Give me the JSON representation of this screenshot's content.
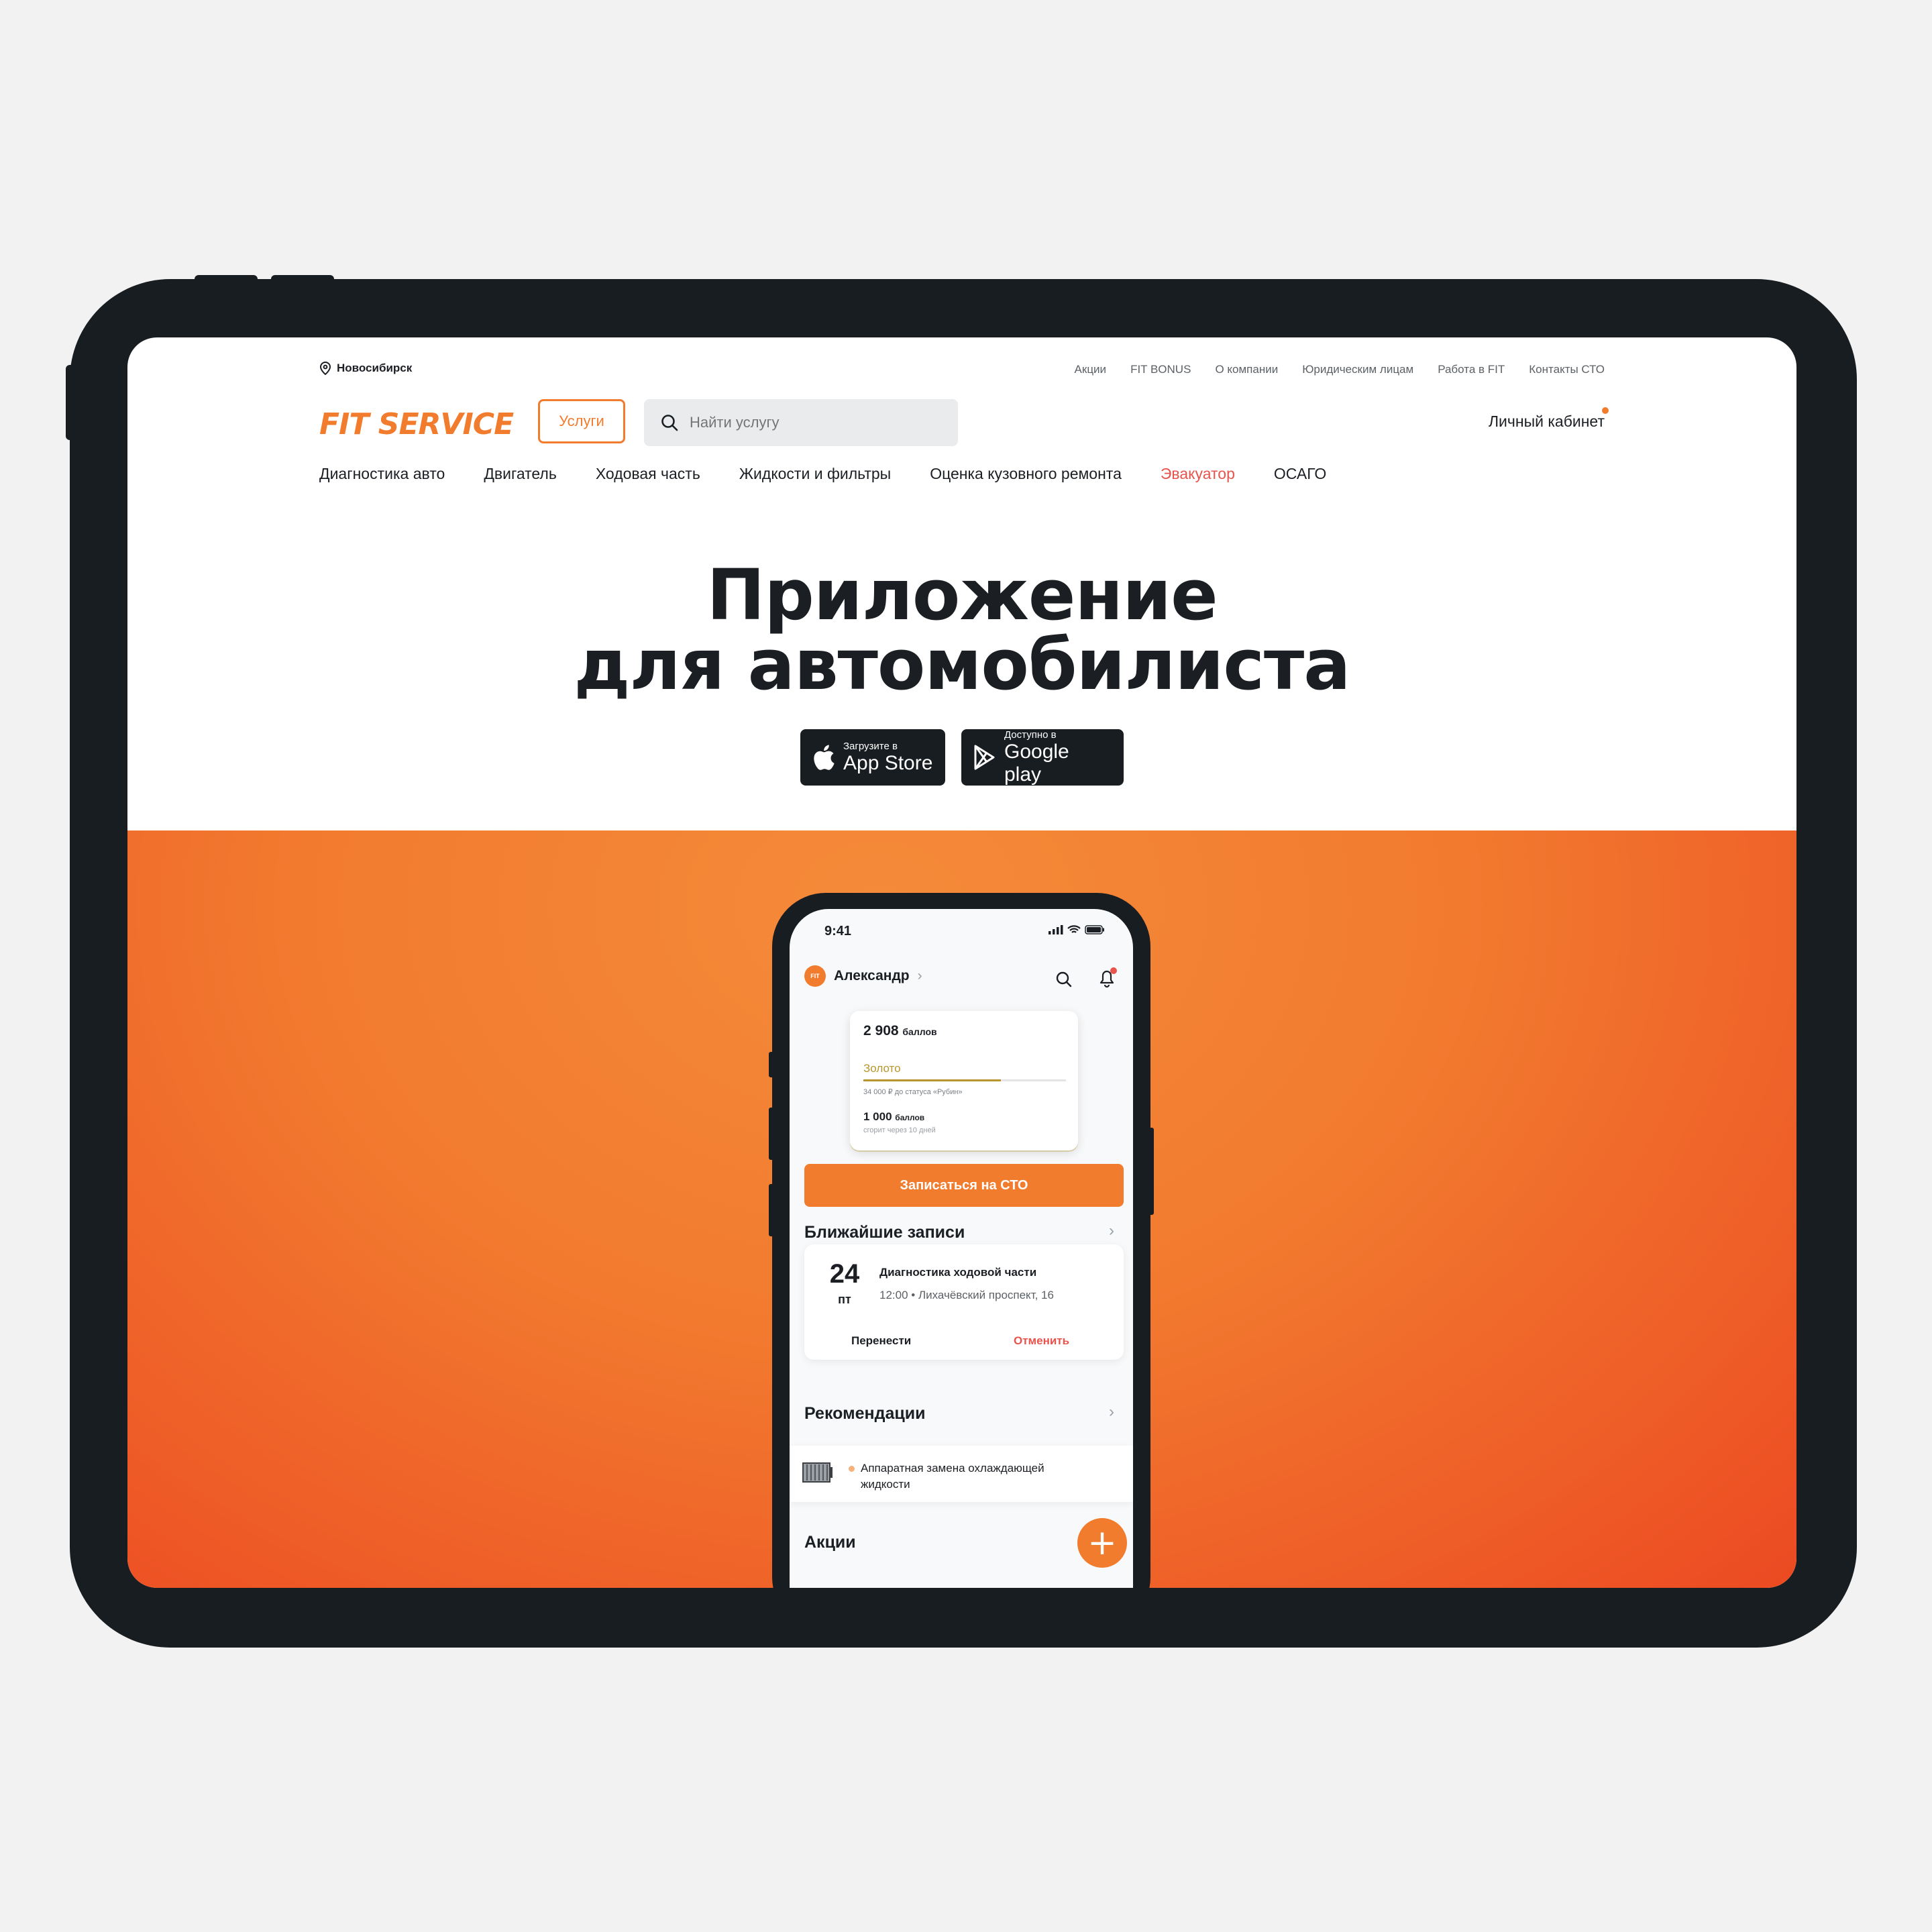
{
  "header": {
    "city": "Новосибирск",
    "top_links": [
      "Акции",
      "FIT BONUS",
      "О компании",
      "Юридическим лицам",
      "Работа в FIT",
      "Контакты СТО"
    ],
    "logo": "FIT SERVICE",
    "services_label": "Услуги",
    "search_placeholder": "Найти услугу",
    "cabinet_label": "Личный кабинет"
  },
  "nav": {
    "items": [
      "Диагностика авто",
      "Двигатель",
      "Ходовая часть",
      "Жидкости и фильтры",
      "Оценка кузовного ремонта",
      "Эвакуатор",
      "ОСАГО"
    ],
    "highlight_color": "#e8534c"
  },
  "hero": {
    "title_line1": "Приложение",
    "title_line2": "для автомобилиста",
    "appstore": {
      "small": "Загрузите в",
      "big": "App Store"
    },
    "googleplay": {
      "small": "Доступно в",
      "big": "Google play"
    }
  },
  "colors": {
    "accent": "#f27c2d",
    "dark": "#181d21",
    "gold": "#b8962e",
    "danger": "#e8534c"
  },
  "phone": {
    "time": "9:41",
    "user_name": "Александр",
    "avatar_text": "FIT",
    "points": {
      "value": "2 908",
      "unit": "баллов",
      "status": "Золото",
      "status_progress": 0.68,
      "to_next": "34 000 ₽ до статуса «Рубин»",
      "expiring_value": "1 000",
      "expiring_unit": "баллов",
      "expiring_note": "сгорит через 10 дней"
    },
    "cta": "Записаться на СТО",
    "upcoming_title": "Ближайшие записи",
    "appointment": {
      "day": "24",
      "weekday": "пт",
      "service": "Диагностика ходовой части",
      "details": "12:00 • Лихачёвский проспект, 16",
      "reschedule": "Перенести",
      "cancel": "Отменить"
    },
    "reco_title": "Рекомендации",
    "reco_item": "Аппаратная замена охлаждающей жидкости",
    "promo_title": "Акции",
    "fab": "+"
  }
}
